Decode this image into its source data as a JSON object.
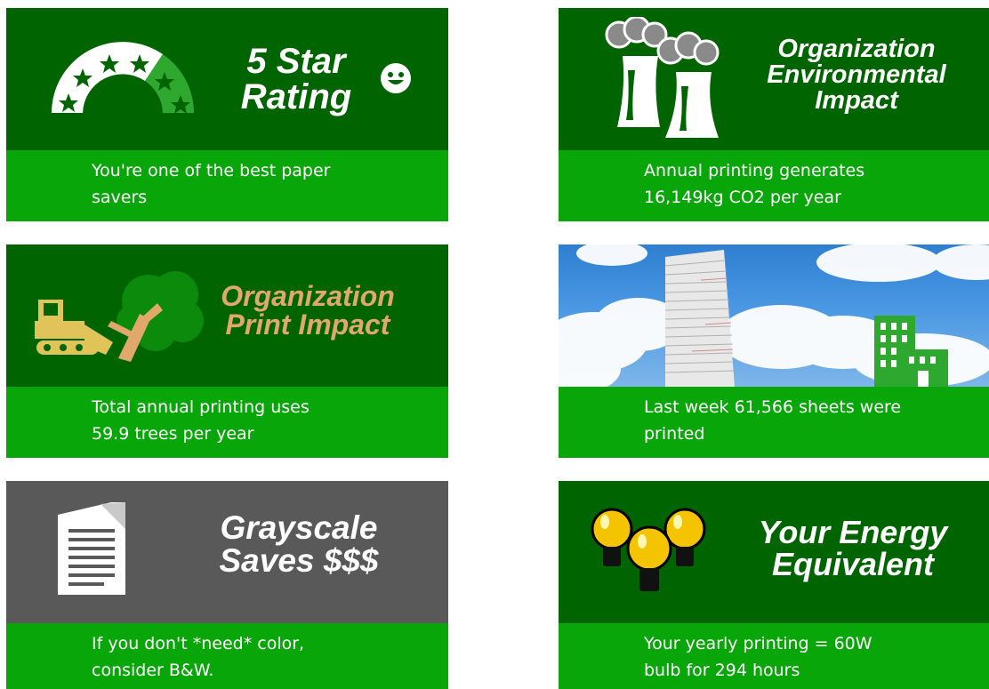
{
  "tiles": {
    "star_rating": {
      "headline": [
        "5 Star",
        "Rating"
      ],
      "badge_number": "5",
      "rating_stars": 5,
      "caption": [
        "You're one of the best paper",
        "savers"
      ]
    },
    "env_impact": {
      "headline": [
        "Organization",
        "Environmental",
        "Impact"
      ],
      "caption": [
        "Annual printing generates",
        "16,149kg CO2 per year"
      ]
    },
    "print_impact": {
      "headline": [
        "Organization",
        "Print Impact"
      ],
      "caption": [
        "Total annual printing uses",
        "59.9 trees per year"
      ]
    },
    "sheets_printed": {
      "caption": [
        "Last week 61,566 sheets were",
        "printed"
      ]
    },
    "grayscale": {
      "headline": [
        "Grayscale",
        "Saves $$$"
      ],
      "caption": [
        "If you don't *need* color,",
        "consider B&W."
      ]
    },
    "energy": {
      "headline": [
        "Your Energy",
        "Equivalent"
      ],
      "caption": [
        "Your yearly printing = 60W",
        "bulb for 294 hours"
      ]
    }
  },
  "colors": {
    "tile_dark_green": "#006400",
    "tile_bright_green": "#09a609",
    "tile_gray": "#595959",
    "headline_tan": "#e0a96b",
    "bulb_yellow": "#f5c400"
  },
  "icons": [
    "star-gauge-icon",
    "smiley-icon",
    "factory-smokestacks-icon",
    "bulldozer-icon",
    "tree-icon",
    "paper-stack-icon",
    "building-icon",
    "document-icon",
    "lightbulb-icon"
  ]
}
